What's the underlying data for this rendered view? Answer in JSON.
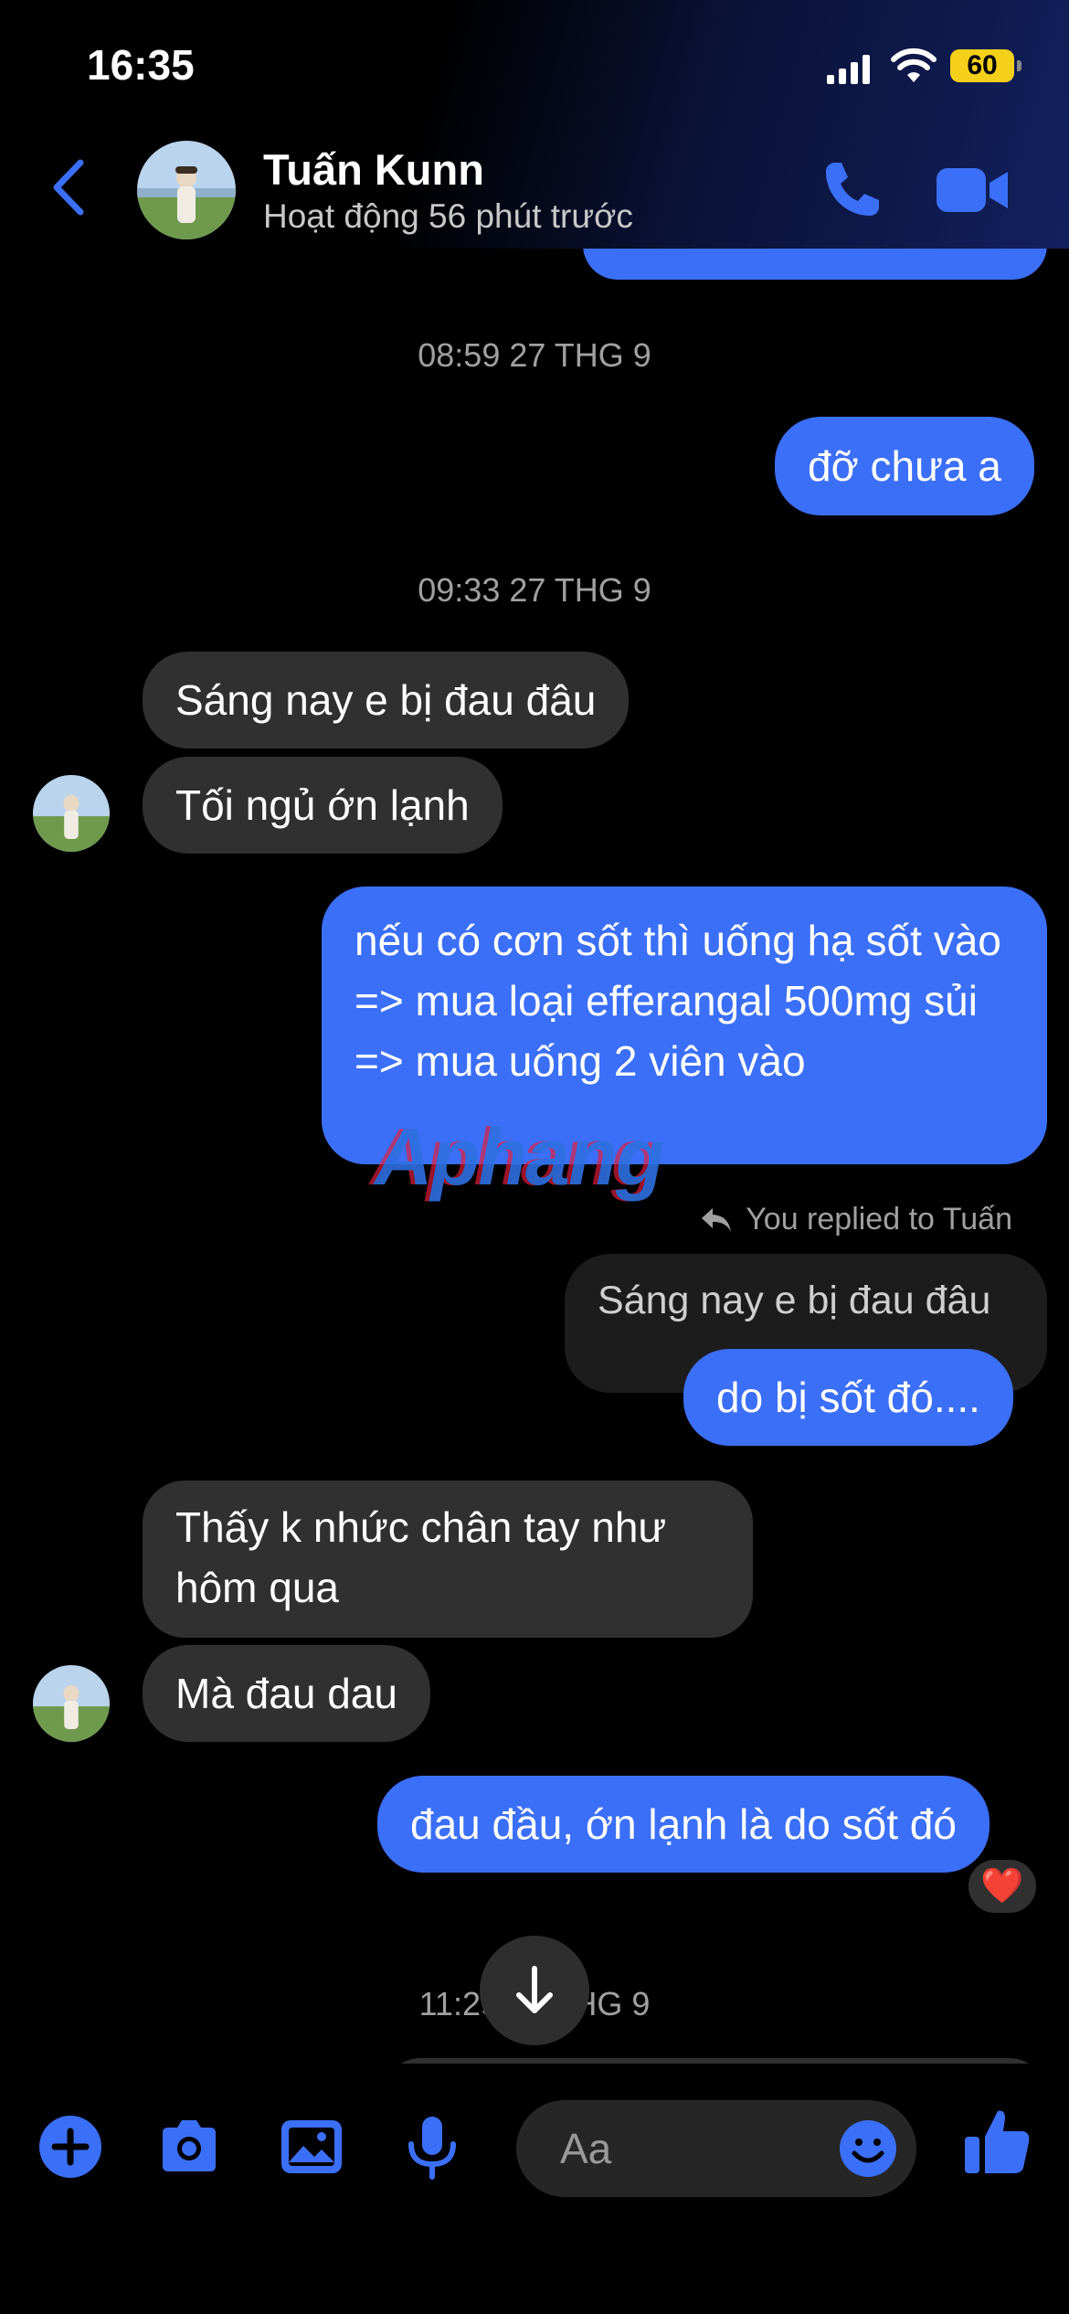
{
  "status_bar": {
    "time": "16:35",
    "battery": "60"
  },
  "header": {
    "contact_name": "Tuấn Kunn",
    "contact_status": "Hoạt động 56 phút trước"
  },
  "conversation": {
    "timestamps": [
      "08:59 27 THG 9",
      "09:33 27 THG 9",
      "11:29 27 THG 9"
    ],
    "msg_me_1": "đỡ chưa a",
    "msg_them_1": "Sáng nay e bị đau đâu",
    "msg_them_2": "Tối ngủ ớn lạnh",
    "msg_me_2": "nếu có cơn sốt thì uống hạ sốt vào => mua loại efferangal 500mg sủi => mua uống 2 viên vào",
    "reply_label": "You replied to Tuấn",
    "quoted_text": "Sáng nay e bị đau đâu",
    "msg_me_3": "do bị sốt đó....",
    "msg_them_3": "Thấy k nhức chân tay như hôm qua",
    "msg_them_4": "Mà đau dau",
    "msg_me_4": "đau đầu, ớn lạnh là do sốt đó",
    "reaction": "❤️"
  },
  "watermark": "Aphang",
  "composer": {
    "placeholder": "Aa"
  },
  "colors": {
    "accent": "#3b6ff7",
    "incoming_bubble": "#303030",
    "background": "#000000"
  },
  "icons": [
    "back-icon",
    "phone-icon",
    "video-icon",
    "plus-icon",
    "camera-icon",
    "image-icon",
    "mic-icon",
    "emoji-icon",
    "like-icon",
    "arrow-down-icon",
    "reply-icon",
    "heart-icon"
  ]
}
